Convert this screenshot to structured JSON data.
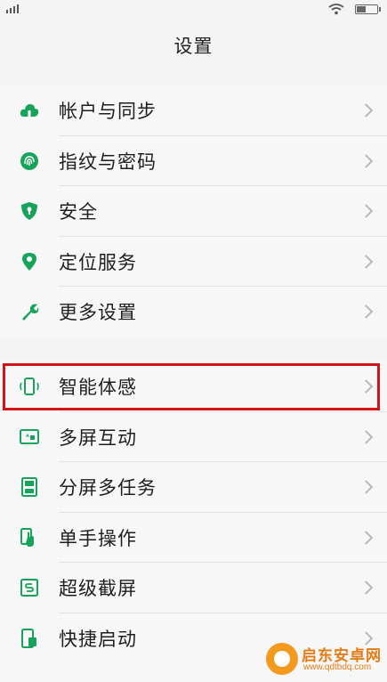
{
  "status_bar": {
    "signal_icon": "signal-icon",
    "wifi_icon": "wifi-icon",
    "battery_icon": "battery-icon"
  },
  "header": {
    "title": "设置"
  },
  "groups": [
    {
      "items": [
        {
          "label": "帐户与同步",
          "icon": "cloud-icon"
        },
        {
          "label": "指纹与密码",
          "icon": "fingerprint-icon"
        },
        {
          "label": "安全",
          "icon": "shield-icon"
        },
        {
          "label": "定位服务",
          "icon": "location-pin-icon"
        },
        {
          "label": "更多设置",
          "icon": "wrench-icon"
        }
      ]
    },
    {
      "items": [
        {
          "label": "智能体感",
          "icon": "phone-motion-icon",
          "highlighted": true
        },
        {
          "label": "多屏互动",
          "icon": "multiscreen-icon"
        },
        {
          "label": "分屏多任务",
          "icon": "split-screen-icon"
        },
        {
          "label": "单手操作",
          "icon": "one-hand-icon"
        },
        {
          "label": "超级截屏",
          "icon": "screenshot-icon"
        },
        {
          "label": "快捷启动",
          "icon": "quick-launch-icon"
        }
      ]
    }
  ],
  "colors": {
    "accent": "#17a35a",
    "highlight_border": "#d41414",
    "chevron": "#b8b8b8"
  },
  "watermark": {
    "name": "启东安卓网",
    "url": "www.qdtbdq.com"
  }
}
